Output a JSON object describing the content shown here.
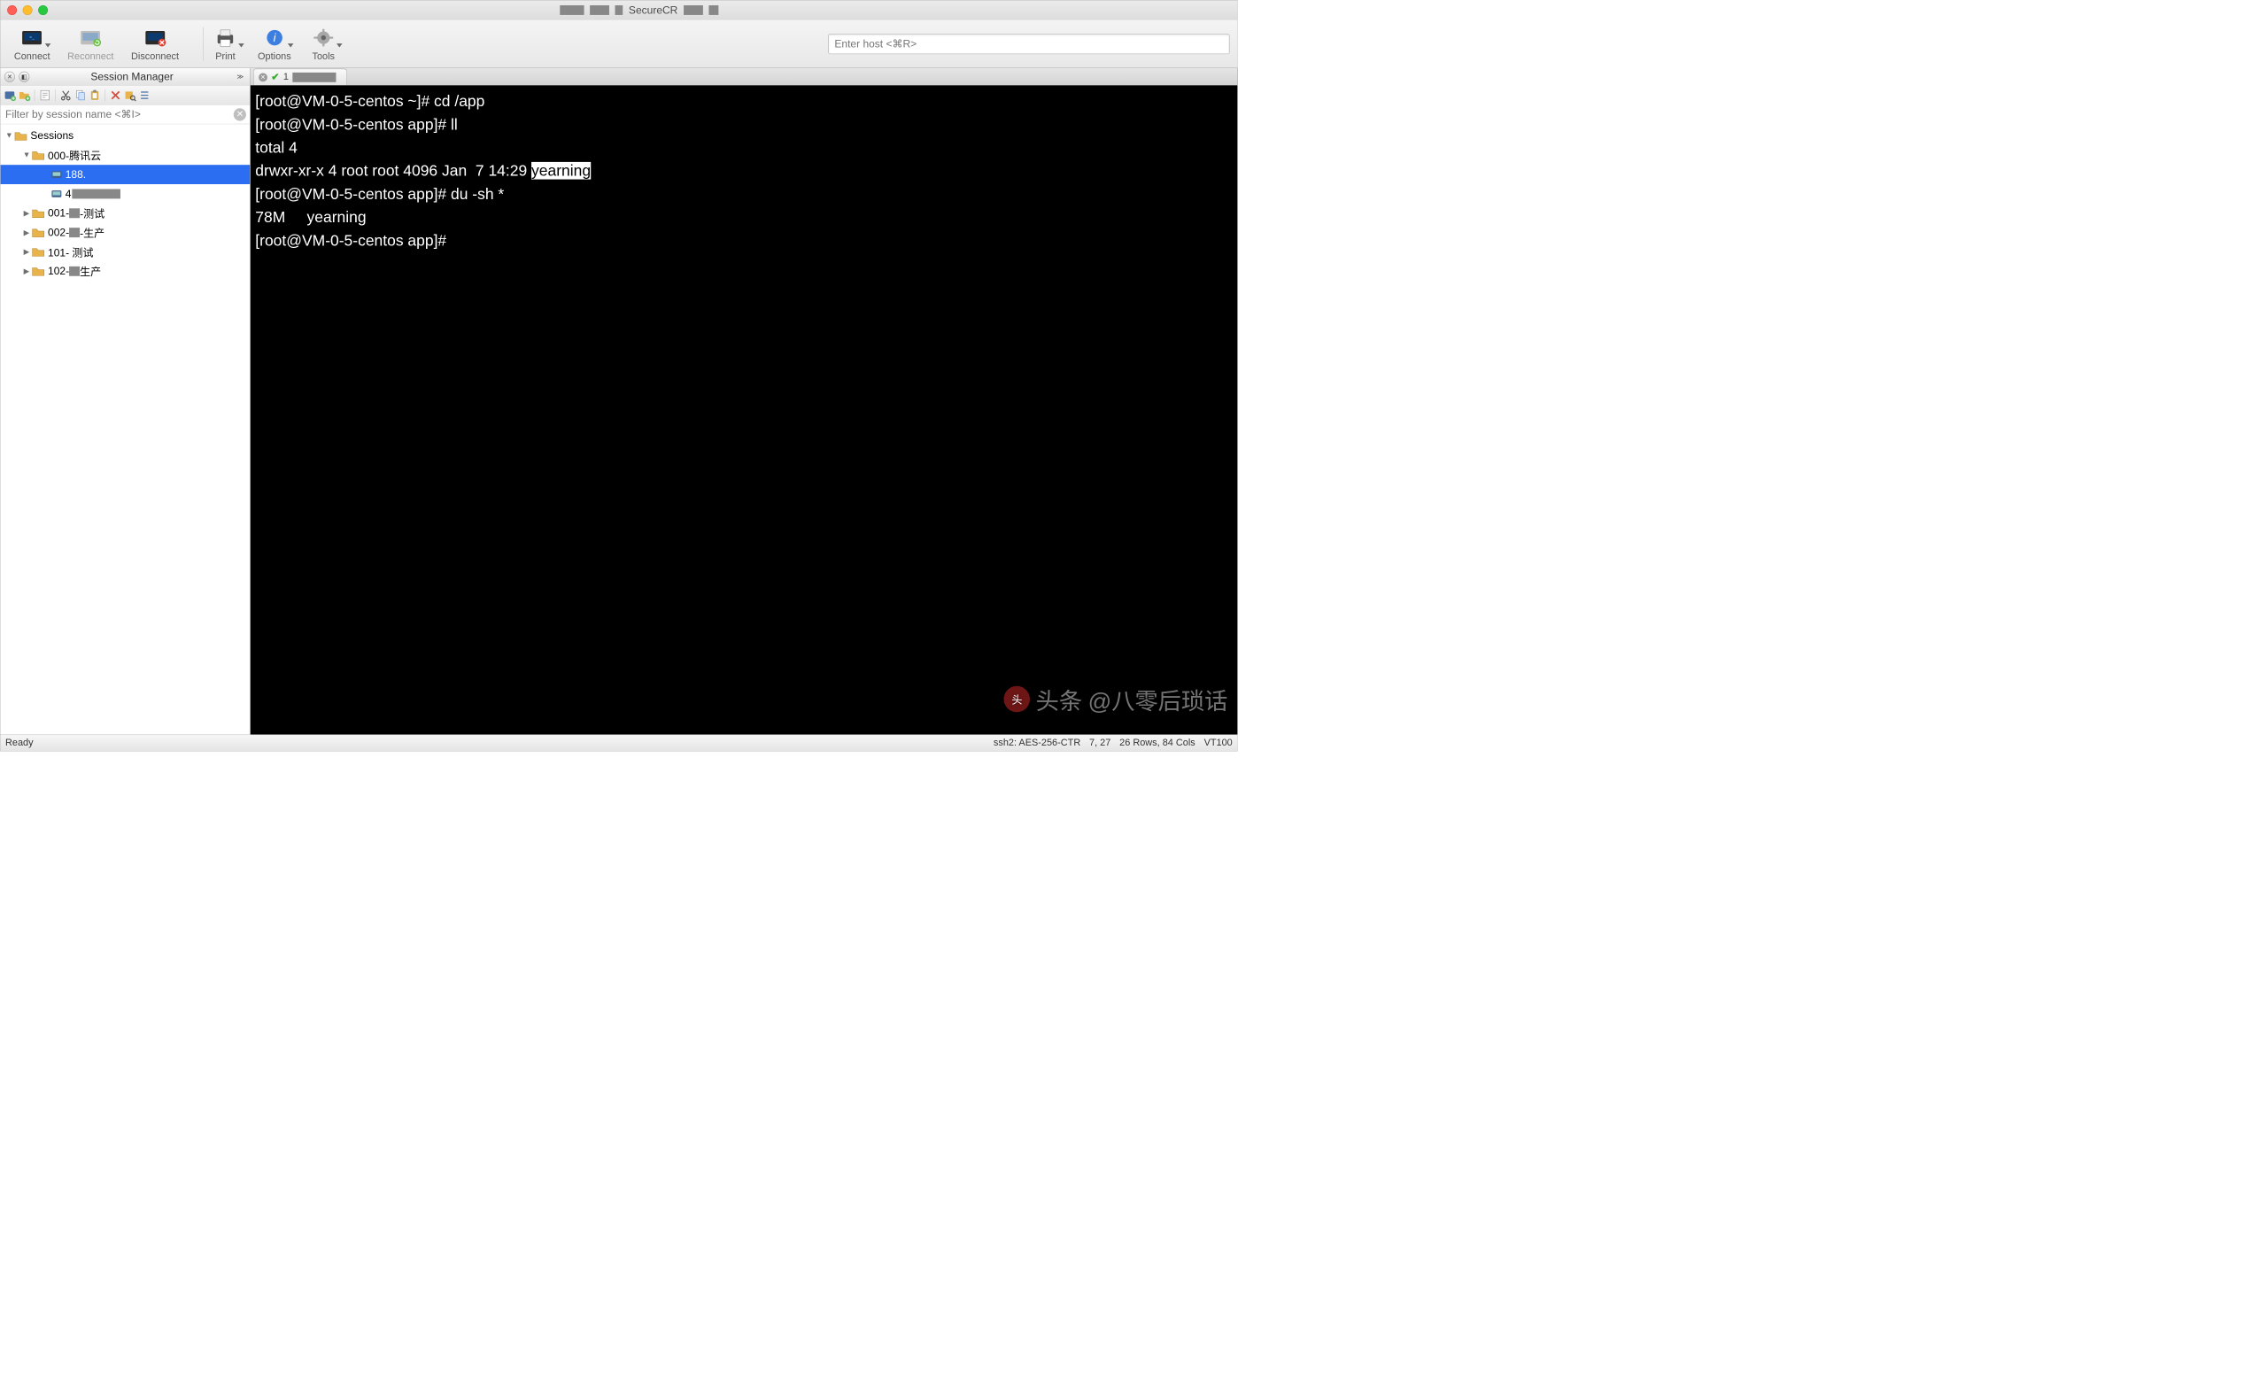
{
  "window": {
    "title": "SecureCR"
  },
  "toolbar": {
    "connect": "Connect",
    "reconnect": "Reconnect",
    "disconnect": "Disconnect",
    "print": "Print",
    "options": "Options",
    "tools": "Tools",
    "host_placeholder": "Enter host <⌘R>"
  },
  "sidebar": {
    "title": "Session Manager",
    "filter_placeholder": "Filter by session name <⌘I>",
    "tree": {
      "root": "Sessions",
      "g0": "000-腾讯云",
      "s0": "188.",
      "s1": "4",
      "g1": "001-",
      "g1b": "-测试",
      "g2": "002-",
      "g2b": "-生产",
      "g3": "101-   测试",
      "g4": "102-",
      "g4b": "生产"
    }
  },
  "tabs": {
    "t1_num": "1"
  },
  "terminal": {
    "l1": "[root@VM-0-5-centos ~]# cd /app",
    "l2": "[root@VM-0-5-centos app]# ll",
    "l3": "total 4",
    "l4a": "drwxr-xr-x 4 root root 4096 Jan  7 14:29 ",
    "l4b": "yearning",
    "l5": "[root@VM-0-5-centos app]# du -sh *",
    "l6": "78M     yearning",
    "l7": "[root@VM-0-5-centos app]# "
  },
  "watermark": {
    "prefix": "头条",
    "text": "@八零后琐话"
  },
  "status": {
    "left": "Ready",
    "ssh": "ssh2: AES-256-CTR",
    "cursor": "7, 27",
    "size": "26 Rows, 84 Cols",
    "term": "VT100"
  }
}
